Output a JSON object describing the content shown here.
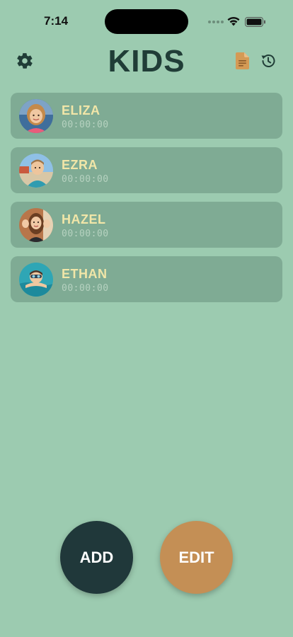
{
  "status_bar": {
    "time": "7:14"
  },
  "header": {
    "title": "KIDS",
    "icons": {
      "settings": "gear-icon",
      "report": "document-icon",
      "history": "history-icon"
    }
  },
  "kids": [
    {
      "name": "ELIZA",
      "timer": "00:00:00"
    },
    {
      "name": "EZRA",
      "timer": "00:00:00"
    },
    {
      "name": "HAZEL",
      "timer": "00:00:00"
    },
    {
      "name": "ETHAN",
      "timer": "00:00:00"
    }
  ],
  "actions": {
    "add_label": "ADD",
    "edit_label": "EDIT"
  },
  "colors": {
    "background": "#9ccbb0",
    "card": "#7fab94",
    "name_text": "#f1e6a8",
    "add_button": "#20383a",
    "edit_button": "#c48f55",
    "report_icon": "#d49a55"
  }
}
